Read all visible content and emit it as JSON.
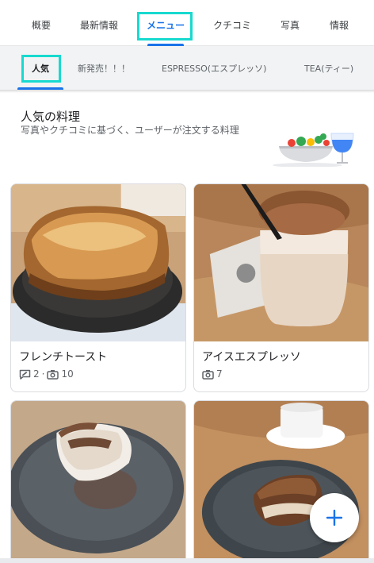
{
  "top_tabs": [
    {
      "label": "概要"
    },
    {
      "label": "最新情報"
    },
    {
      "label": "メニュー"
    },
    {
      "label": "クチコミ"
    },
    {
      "label": "写真"
    },
    {
      "label": "情報"
    }
  ],
  "sub_tabs": [
    {
      "label": "人気"
    },
    {
      "label": "新発売！！！"
    },
    {
      "label": "ESPRESSO(エスプレッソ)"
    },
    {
      "label": "TEA(ティー)"
    }
  ],
  "section": {
    "title": "人気の料理",
    "description": "写真やクチコミに基づく、ユーザーが注文する料理"
  },
  "cards": [
    {
      "name": "フレンチトースト",
      "reviews": "2",
      "separator": "·",
      "photos": "10"
    },
    {
      "name": "アイスエスプレッソ",
      "photos": "7"
    }
  ],
  "colors": {
    "accent": "#1a73e8",
    "highlight": "#18d9cf"
  },
  "icons": {
    "review": "review-icon",
    "camera": "camera-icon",
    "add": "plus-icon"
  }
}
